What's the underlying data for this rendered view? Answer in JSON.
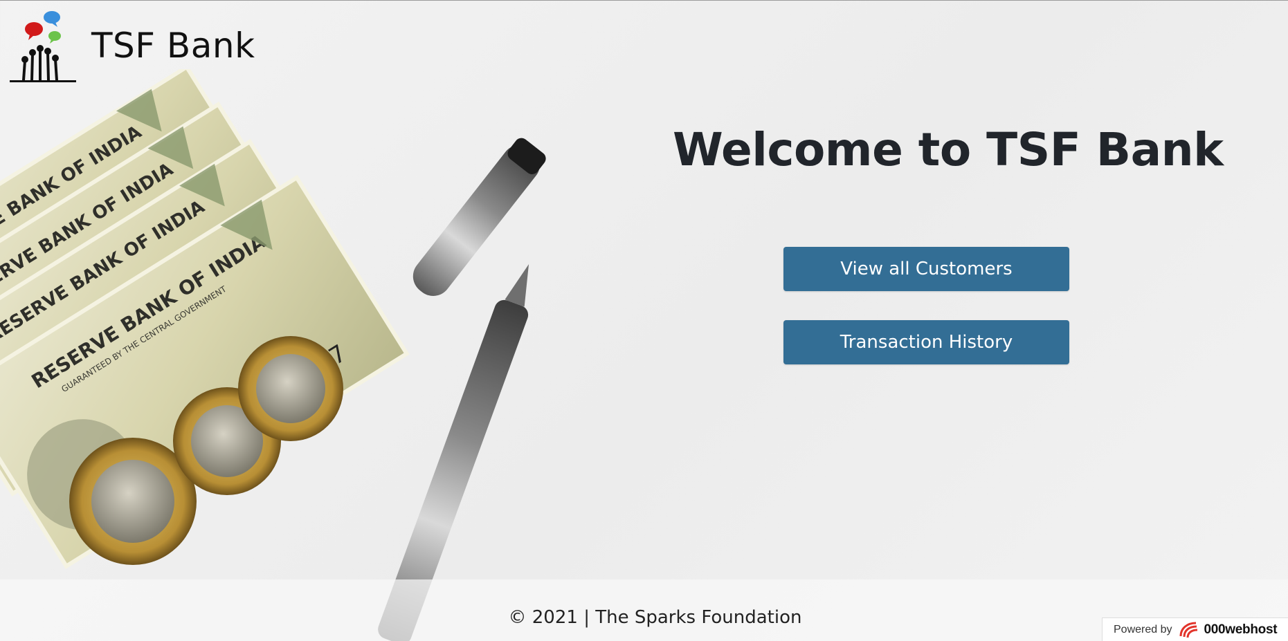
{
  "header": {
    "brand_name": "TSF Bank",
    "logo_icon": "raised-hands-speech-bubbles-icon"
  },
  "hero": {
    "title": "Welcome to TSF Bank",
    "buttons": {
      "customers_label": "View all Customers",
      "history_label": "Transaction History"
    },
    "button_color": "#336e95"
  },
  "illustration": {
    "subject": "currency-notes-coins-pen-photo",
    "note_text": "RESERVE BANK OF INDIA",
    "note_subtext": "GUARANTEED BY THE CENTRAL GOVERNMENT",
    "serial": "5LM 728187"
  },
  "footer": {
    "text": "© 2021 | The Sparks Foundation"
  },
  "badge": {
    "powered_by": "Powered by",
    "host_name": "000webhost"
  }
}
